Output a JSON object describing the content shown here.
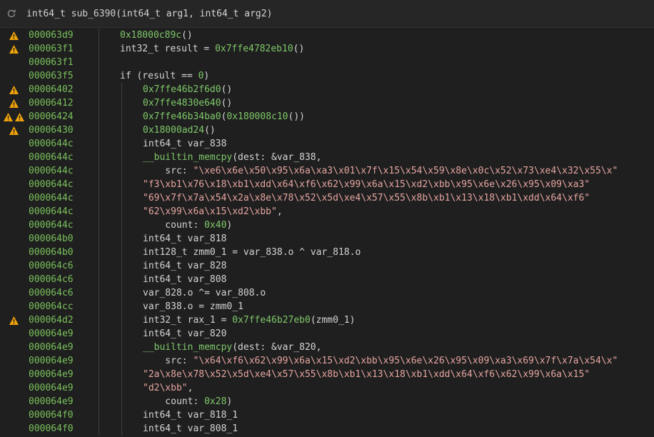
{
  "header": {
    "ret_type": "int64_t",
    "func_name": "sub_6390",
    "params": "(int64_t arg1, int64_t arg2)"
  },
  "lines": [
    {
      "addr": "000063d9",
      "warn": 1,
      "indent": 1,
      "tokens": [
        [
          "hex",
          "0x18000c89c"
        ],
        [
          "plain",
          "()"
        ]
      ]
    },
    {
      "addr": "000063f1",
      "warn": 1,
      "indent": 1,
      "tokens": [
        [
          "ty",
          "int32_t "
        ],
        [
          "plain",
          "result = "
        ],
        [
          "hex",
          "0x7ffe4782eb10"
        ],
        [
          "plain",
          "()"
        ]
      ]
    },
    {
      "addr": "000063f1",
      "warn": 0,
      "indent": 1,
      "tokens": []
    },
    {
      "addr": "000063f5",
      "warn": 0,
      "indent": 1,
      "tokens": [
        [
          "kw",
          "if "
        ],
        [
          "plain",
          "(result == "
        ],
        [
          "num",
          "0"
        ],
        [
          "plain",
          ")"
        ]
      ]
    },
    {
      "addr": "00006402",
      "warn": 1,
      "indent": 2,
      "tokens": [
        [
          "hex",
          "0x7ffe46b2f6d0"
        ],
        [
          "plain",
          "()"
        ]
      ]
    },
    {
      "addr": "00006412",
      "warn": 1,
      "indent": 2,
      "tokens": [
        [
          "hex",
          "0x7ffe4830e640"
        ],
        [
          "plain",
          "()"
        ]
      ]
    },
    {
      "addr": "00006424",
      "warn": 2,
      "indent": 2,
      "tokens": [
        [
          "hex",
          "0x7ffe46b34ba0"
        ],
        [
          "plain",
          "("
        ],
        [
          "hex",
          "0x180008c10"
        ],
        [
          "plain",
          "())"
        ]
      ]
    },
    {
      "addr": "00006430",
      "warn": 1,
      "indent": 2,
      "tokens": [
        [
          "hex",
          "0x18000ad24"
        ],
        [
          "plain",
          "()"
        ]
      ]
    },
    {
      "addr": "0000644c",
      "warn": 0,
      "indent": 2,
      "tokens": [
        [
          "ty",
          "int64_t "
        ],
        [
          "plain",
          "var_838"
        ]
      ]
    },
    {
      "addr": "0000644c",
      "warn": 0,
      "indent": 2,
      "tokens": [
        [
          "hex",
          "__builtin_memcpy"
        ],
        [
          "plain",
          "(dest: &var_838,"
        ]
      ]
    },
    {
      "addr": "0000644c",
      "warn": 0,
      "indent": 2,
      "tokens": [
        [
          "plain",
          "    src: "
        ],
        [
          "str",
          "\"\\xe6\\x6e\\x50\\x95\\x6a\\xa3\\x01\\x7f\\x15\\x54\\x59\\x8e\\x0c\\x52\\x73\\xe4\\x32\\x55\\x\""
        ]
      ]
    },
    {
      "addr": "0000644c",
      "warn": 0,
      "indent": 2,
      "tokens": [
        [
          "str",
          "\"f3\\xb1\\x76\\x18\\xb1\\xdd\\x64\\xf6\\x62\\x99\\x6a\\x15\\xd2\\xbb\\x95\\x6e\\x26\\x95\\x09\\xa3\""
        ]
      ]
    },
    {
      "addr": "0000644c",
      "warn": 0,
      "indent": 2,
      "tokens": [
        [
          "str",
          "\"69\\x7f\\x7a\\x54\\x2a\\x8e\\x78\\x52\\x5d\\xe4\\x57\\x55\\x8b\\xb1\\x13\\x18\\xb1\\xdd\\x64\\xf6\""
        ]
      ]
    },
    {
      "addr": "0000644c",
      "warn": 0,
      "indent": 2,
      "tokens": [
        [
          "str",
          "\"62\\x99\\x6a\\x15\\xd2\\xbb\""
        ],
        [
          "plain",
          ","
        ]
      ]
    },
    {
      "addr": "0000644c",
      "warn": 0,
      "indent": 2,
      "tokens": [
        [
          "plain",
          "    count: "
        ],
        [
          "num",
          "0x40"
        ],
        [
          "plain",
          ")"
        ]
      ]
    },
    {
      "addr": "000064b0",
      "warn": 0,
      "indent": 2,
      "tokens": [
        [
          "ty",
          "int64_t "
        ],
        [
          "plain",
          "var_818"
        ]
      ]
    },
    {
      "addr": "000064b0",
      "warn": 0,
      "indent": 2,
      "tokens": [
        [
          "ty",
          "int128_t "
        ],
        [
          "plain",
          "zmm0_1 = var_838"
        ],
        [
          "fld",
          ".o"
        ],
        [
          "plain",
          " ^ var_818"
        ],
        [
          "fld",
          ".o"
        ]
      ]
    },
    {
      "addr": "000064c6",
      "warn": 0,
      "indent": 2,
      "tokens": [
        [
          "ty",
          "int64_t "
        ],
        [
          "plain",
          "var_828"
        ]
      ]
    },
    {
      "addr": "000064c6",
      "warn": 0,
      "indent": 2,
      "tokens": [
        [
          "ty",
          "int64_t "
        ],
        [
          "plain",
          "var_808"
        ]
      ]
    },
    {
      "addr": "000064c6",
      "warn": 0,
      "indent": 2,
      "tokens": [
        [
          "plain",
          "var_828"
        ],
        [
          "fld",
          ".o"
        ],
        [
          "plain",
          " ^= var_808"
        ],
        [
          "fld",
          ".o"
        ]
      ]
    },
    {
      "addr": "000064cc",
      "warn": 0,
      "indent": 2,
      "tokens": [
        [
          "plain",
          "var_838"
        ],
        [
          "fld",
          ".o"
        ],
        [
          "plain",
          " = zmm0_1"
        ]
      ]
    },
    {
      "addr": "000064d2",
      "warn": 1,
      "indent": 2,
      "tokens": [
        [
          "ty",
          "int32_t "
        ],
        [
          "plain",
          "rax_1 = "
        ],
        [
          "hex",
          "0x7ffe46b27eb0"
        ],
        [
          "plain",
          "(zmm0_1)"
        ]
      ]
    },
    {
      "addr": "000064e9",
      "warn": 0,
      "indent": 2,
      "tokens": [
        [
          "ty",
          "int64_t "
        ],
        [
          "plain",
          "var_820"
        ]
      ]
    },
    {
      "addr": "000064e9",
      "warn": 0,
      "indent": 2,
      "tokens": [
        [
          "hex",
          "__builtin_memcpy"
        ],
        [
          "plain",
          "(dest: &var_820,"
        ]
      ]
    },
    {
      "addr": "000064e9",
      "warn": 0,
      "indent": 2,
      "tokens": [
        [
          "plain",
          "    src: "
        ],
        [
          "str",
          "\"\\x64\\xf6\\x62\\x99\\x6a\\x15\\xd2\\xbb\\x95\\x6e\\x26\\x95\\x09\\xa3\\x69\\x7f\\x7a\\x54\\x\""
        ]
      ]
    },
    {
      "addr": "000064e9",
      "warn": 0,
      "indent": 2,
      "tokens": [
        [
          "str",
          "\"2a\\x8e\\x78\\x52\\x5d\\xe4\\x57\\x55\\x8b\\xb1\\x13\\x18\\xb1\\xdd\\x64\\xf6\\x62\\x99\\x6a\\x15\""
        ]
      ]
    },
    {
      "addr": "000064e9",
      "warn": 0,
      "indent": 2,
      "tokens": [
        [
          "str",
          "\"d2\\xbb\""
        ],
        [
          "plain",
          ","
        ]
      ]
    },
    {
      "addr": "000064e9",
      "warn": 0,
      "indent": 2,
      "tokens": [
        [
          "plain",
          "    count: "
        ],
        [
          "num",
          "0x28"
        ],
        [
          "plain",
          ")"
        ]
      ]
    },
    {
      "addr": "000064f0",
      "warn": 0,
      "indent": 2,
      "tokens": [
        [
          "ty",
          "int64_t "
        ],
        [
          "plain",
          "var_818_1"
        ]
      ]
    },
    {
      "addr": "000064f0",
      "warn": 0,
      "indent": 2,
      "tokens": [
        [
          "ty",
          "int64_t "
        ],
        [
          "plain",
          "var_808_1"
        ]
      ]
    }
  ],
  "colors": {
    "address": "#79c05b",
    "hex_literal": "#7fc86a",
    "string": "#e5a5a0",
    "warning": "#f0a30a",
    "background": "#1f1f1f"
  },
  "icons": {
    "refresh": "refresh-icon",
    "warning": "warning-icon"
  }
}
